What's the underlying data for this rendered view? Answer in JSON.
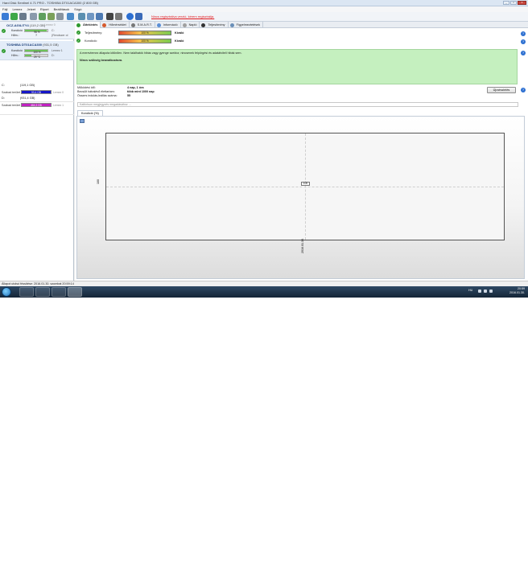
{
  "window": {
    "title": "Hard Disk Sentinel 4.71 PRO - TOSHIBA DT01ACA300 (2 800 GB)",
    "controls": [
      "_",
      "□",
      "✕"
    ]
  },
  "menu": [
    "Fájl",
    "Lemez",
    "Jelzet",
    "Riport",
    "Beállítások",
    "Súgó"
  ],
  "toolbar": {
    "register_warning": "Nincs regisztrálva verzió, kérem regisztrálja."
  },
  "disks": [
    {
      "name": "OCZ-AGILITY4",
      "size": "(119,2 GB)",
      "state": "Lemez 0",
      "condition_label": "Kondíció",
      "condition": "96 %",
      "condition_fill": 96,
      "condition_right": "C:",
      "temp_label": "Hőm.:",
      "temp": "?",
      "temp_right": "(Rendszer ol"
    },
    {
      "name": "TOSHIBA DT01ACA300",
      "size": "(931,5 GB)",
      "state": "",
      "condition_label": "Kondíció",
      "condition": "100 %",
      "condition_fill": 100,
      "condition_right": "Lemez 1",
      "temp_label": "Hőm.:",
      "temp": "29 °C",
      "temp_right": "D:"
    }
  ],
  "volumes": [
    {
      "letter": "C:",
      "size": "(119,1 GB)",
      "free_label": "Szabad terület",
      "free": "53,4 GB",
      "free_pct": 45,
      "disk": "Lemez 0",
      "color": "#1515c8"
    },
    {
      "letter": "D:",
      "size": "(931,4 GB)",
      "free_label": "Szabad terület",
      "free": "464,3 GB",
      "free_pct": 50,
      "disk": "Lemez 1",
      "color": "#c020c0"
    }
  ],
  "tabs": [
    "Áttekintés",
    "Hőmérséklet",
    "S.M.A.R.T.",
    "Információ",
    "Napló",
    "Teljesítmény",
    "Figyelmeztetések"
  ],
  "metrics": [
    {
      "label": "Teljesítmény:",
      "value_pct": "100 %",
      "status": "Kiváló"
    },
    {
      "label": "Kondíció:",
      "value_pct": "100 %",
      "status": "Kiváló"
    }
  ],
  "note": {
    "line1": "A merevlemez állapota kitűnően. Nem találhatók hibás vagy gyenge szektor, nincsenek felpörgési és adatátviteli hibák sem.",
    "line2": "Nincs szükség beavatkozásra."
  },
  "stats": [
    {
      "label": "Működési idő:",
      "value": "4 nap, 1 óra"
    },
    {
      "label": "Becsült hátralévő élettartam:",
      "value": "több mint 1000 nap"
    },
    {
      "label": "Összes indulás-leállás száma:",
      "value": "55"
    }
  ],
  "refresh_button": "Újraészlelés",
  "comment_placeholder": "Kattintson megjegyzés megadásához ...",
  "chart_tab": "Kondíció (%)",
  "chart_data": {
    "type": "line",
    "title": "",
    "x": [
      "2016.01.30."
    ],
    "series": [
      {
        "values": [
          100
        ]
      }
    ],
    "ylabel": "100",
    "xlabel": "2016.01.30.",
    "data_labels": [
      "100"
    ],
    "grid": true
  },
  "status_bar": "Állapot utolsó frissítése: 2016.01.30. szombat 20:59:14",
  "tray": {
    "lang": "HU",
    "time": "20:59",
    "date": "2016.01.30."
  }
}
